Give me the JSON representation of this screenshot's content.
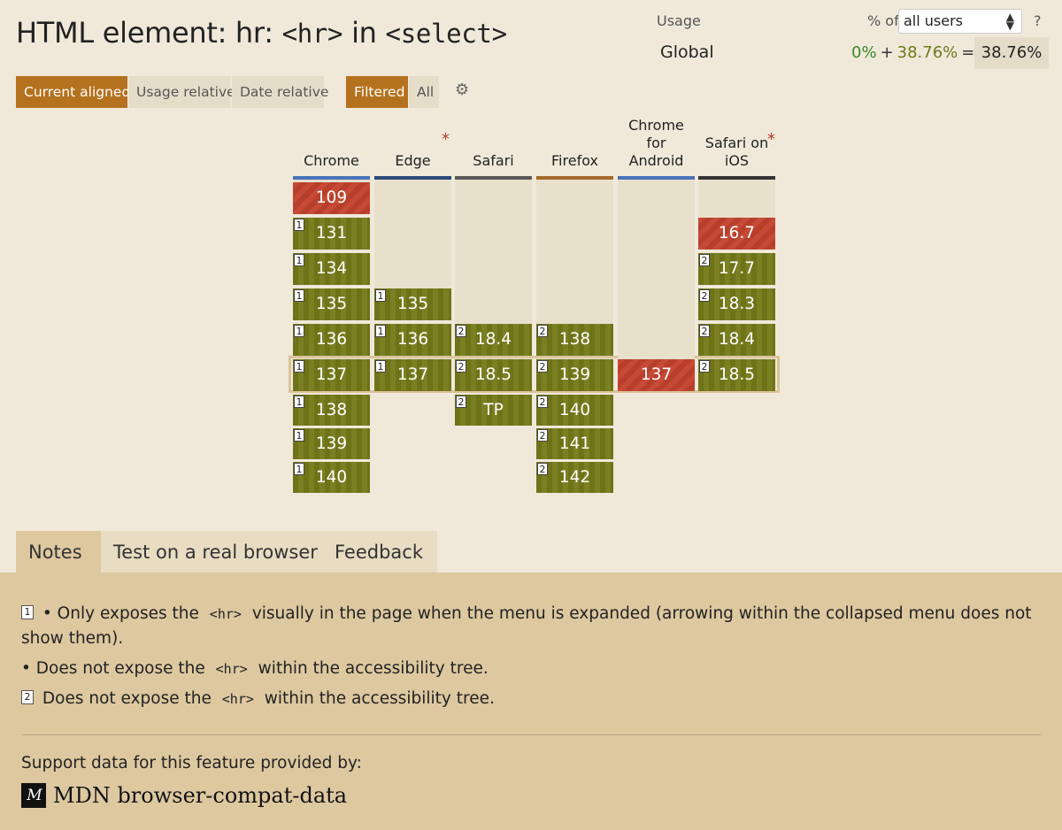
{
  "title": {
    "prefix": "HTML element: hr: ",
    "code1": "<hr>",
    "middle": " in ",
    "code2": "<select>"
  },
  "usage": {
    "label": "Usage",
    "pct_of": "% of",
    "select_value": "all users",
    "help": "?",
    "global_label": "Global",
    "supported": "0%",
    "plus": "+",
    "partial": "38.76%",
    "equals": "=",
    "total": "38.76%"
  },
  "toggles": {
    "current_aligned": "Current aligned",
    "usage_relative": "Usage relative",
    "date_relative": "Date relative",
    "filtered": "Filtered",
    "all": "All"
  },
  "browsers": [
    {
      "name": "Chrome",
      "bar_color": "#4a73b8",
      "star": ""
    },
    {
      "name": "Edge",
      "bar_color": "#2b4a7a",
      "star": "*"
    },
    {
      "name": "Safari",
      "bar_color": "#5a5a5a",
      "star": ""
    },
    {
      "name": "Firefox",
      "bar_color": "#a56a2a",
      "star": ""
    },
    {
      "name": "Chrome for Android",
      "bar_color": "#4a73b8",
      "star": ""
    },
    {
      "name": "Safari on iOS",
      "bar_color": "#333333",
      "star": "*"
    }
  ],
  "cells": {
    "chrome": [
      {
        "version": "109",
        "status": "n",
        "note": ""
      },
      {
        "version": "131",
        "status": "y",
        "note": "1"
      },
      {
        "version": "134",
        "status": "y",
        "note": "1"
      },
      {
        "version": "135",
        "status": "y",
        "note": "1"
      },
      {
        "version": "136",
        "status": "y",
        "note": "1"
      },
      {
        "version": "137",
        "status": "y",
        "note": "1"
      },
      {
        "version": "138",
        "status": "y",
        "note": "1"
      },
      {
        "version": "139",
        "status": "y",
        "note": "1"
      },
      {
        "version": "140",
        "status": "y",
        "note": "1"
      }
    ],
    "edge": [
      {
        "version": "135",
        "status": "y",
        "note": "1"
      },
      {
        "version": "136",
        "status": "y",
        "note": "1"
      },
      {
        "version": "137",
        "status": "y",
        "note": "1"
      }
    ],
    "safari": [
      {
        "version": "18.4",
        "status": "y",
        "note": "2"
      },
      {
        "version": "18.5",
        "status": "y",
        "note": "2"
      },
      {
        "version": "TP",
        "status": "y",
        "note": "2"
      }
    ],
    "firefox": [
      {
        "version": "138",
        "status": "y",
        "note": "2"
      },
      {
        "version": "139",
        "status": "y",
        "note": "2"
      },
      {
        "version": "140",
        "status": "y",
        "note": "2"
      },
      {
        "version": "141",
        "status": "y",
        "note": "2"
      },
      {
        "version": "142",
        "status": "y",
        "note": "2"
      }
    ],
    "chrome_android": [
      {
        "version": "137",
        "status": "n",
        "note": ""
      }
    ],
    "safari_ios": [
      {
        "version": "16.7",
        "status": "n",
        "note": ""
      },
      {
        "version": "17.7",
        "status": "y",
        "note": "2"
      },
      {
        "version": "18.3",
        "status": "y",
        "note": "2"
      },
      {
        "version": "18.4",
        "status": "y",
        "note": "2"
      },
      {
        "version": "18.5",
        "status": "y",
        "note": "2"
      }
    ]
  },
  "tabs": {
    "notes": "Notes",
    "test": "Test on a real browser",
    "feedback": "Feedback"
  },
  "notes": {
    "n1_marker": "1",
    "n1_a_pre": "• Only exposes the",
    "n1_a_code": "<hr>",
    "n1_a_post": "visually in the page when the menu is expanded (arrowing within the collapsed menu does not show them).",
    "n1_b_pre": "• Does not expose the",
    "n1_b_code": "<hr>",
    "n1_b_post": "within the accessibility tree.",
    "n2_marker": "2",
    "n2_pre": "Does not expose the",
    "n2_code": "<hr>",
    "n2_post": "within the accessibility tree."
  },
  "support": {
    "text": "Support data for this feature provided by:",
    "logo_glyph": "M",
    "brand": "MDN browser-compat-data"
  }
}
